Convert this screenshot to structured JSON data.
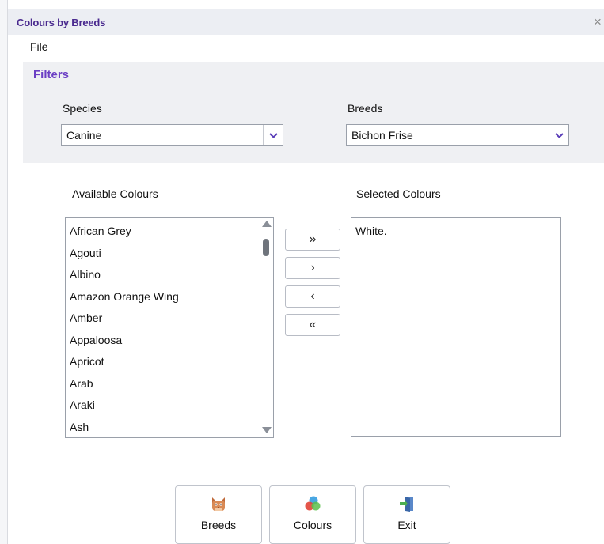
{
  "window": {
    "title": "Colours by Breeds",
    "close_glyph": "×"
  },
  "menu": {
    "file": "File"
  },
  "filters": {
    "title": "Filters",
    "species": {
      "label": "Species",
      "value": "Canine"
    },
    "breeds": {
      "label": "Breeds",
      "value": "Bichon Frise"
    }
  },
  "available": {
    "label": "Available Colours",
    "items": [
      "African Grey",
      "Agouti",
      "Albino",
      "Amazon Orange Wing",
      "Amber",
      "Appaloosa",
      "Apricot",
      "Arab",
      "Araki",
      "Ash"
    ]
  },
  "selected": {
    "label": "Selected Colours",
    "items": [
      "White."
    ]
  },
  "move_buttons": {
    "add_all": "»",
    "add_one": "›",
    "remove_one": "‹",
    "remove_all": "«"
  },
  "actions": {
    "breeds": "Breeds",
    "colours": "Colours",
    "exit": "Exit"
  },
  "icons": {
    "breeds": "cat-face-icon",
    "colours": "colour-circles-icon",
    "exit": "exit-door-icon",
    "dropdown": "chevron-down-icon"
  },
  "colors": {
    "title": "#4a2a8f",
    "filters_title": "#6b3fc4",
    "chevron": "#5a3db8"
  }
}
